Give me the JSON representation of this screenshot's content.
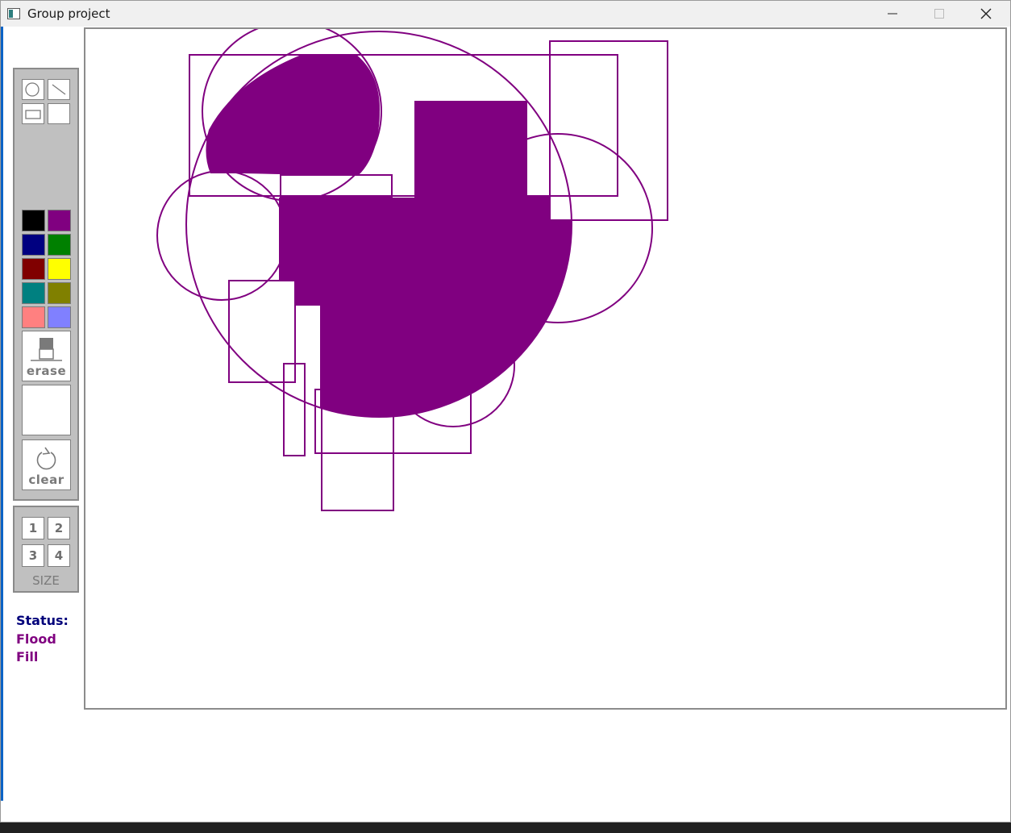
{
  "window": {
    "title": "Group project",
    "minimize_icon": "minimize-icon",
    "maximize_icon": "maximize-icon",
    "close_icon": "close-icon"
  },
  "tools": {
    "shapes": [
      {
        "name": "circle-tool",
        "icon": "circle-icon"
      },
      {
        "name": "line-tool",
        "icon": "line-icon"
      },
      {
        "name": "rectangle-tool",
        "icon": "rectangle-icon"
      },
      {
        "name": "fill-tool",
        "icon": "blank"
      }
    ],
    "palette": [
      "#000000",
      "#800080",
      "#000080",
      "#008000",
      "#800000",
      "#ffff00",
      "#008080",
      "#808000",
      "#ff8080",
      "#8080ff"
    ],
    "erase_label": "erase",
    "clear_label": "clear",
    "size_buttons": [
      "1",
      "2",
      "3",
      "4"
    ],
    "size_label": "SIZE"
  },
  "status": {
    "label": "Status:",
    "value": "Flood Fill"
  },
  "canvas": {
    "stroke_color": "#800080",
    "fill_color": "#800080"
  }
}
